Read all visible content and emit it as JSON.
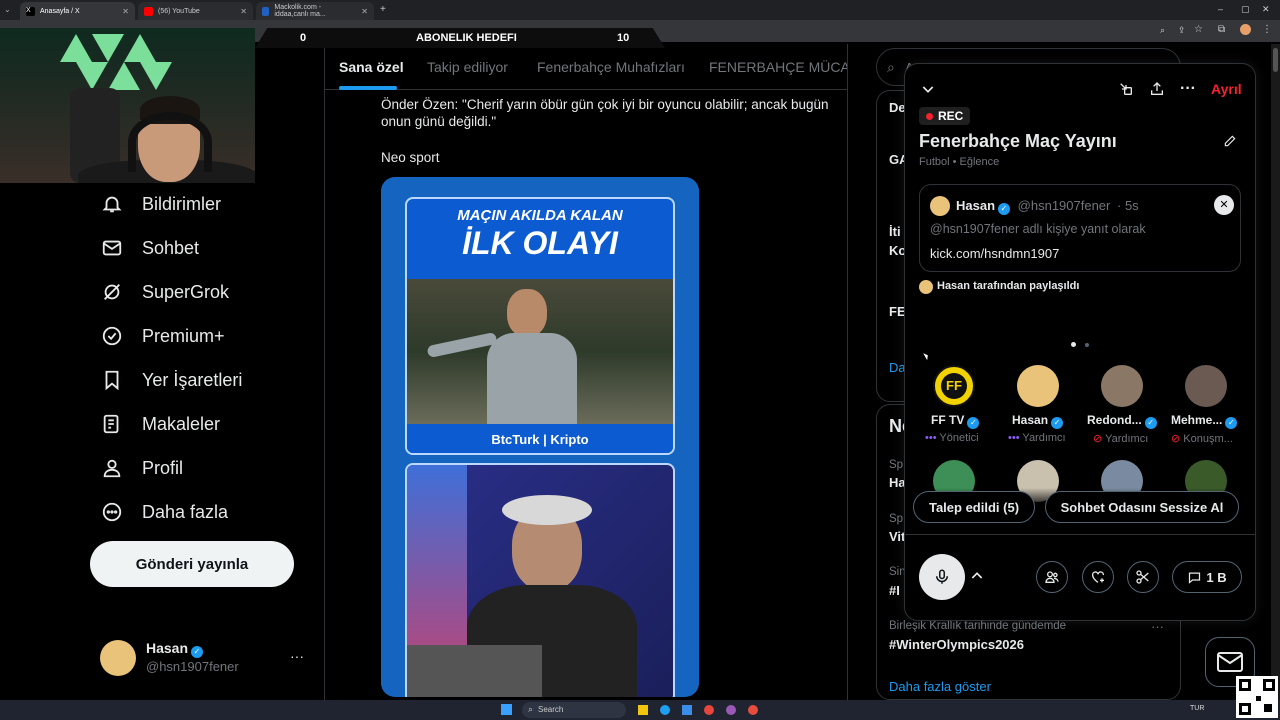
{
  "browser": {
    "tabs": [
      {
        "title": "Anasayfa / X",
        "active": true
      },
      {
        "title": "(56) YouTube",
        "active": false
      },
      {
        "title": "Mackolik.com - iddaa,canlı ma...",
        "active": false
      }
    ],
    "new_tab": "+"
  },
  "overlay": {
    "left_count": "0",
    "goal_label": "ABONELIK HEDEFI",
    "right_count": "10"
  },
  "nav": {
    "items": [
      {
        "label": "Bildirimler",
        "icon": "bell-icon"
      },
      {
        "label": "Sohbet",
        "icon": "mail-icon"
      },
      {
        "label": "SuperGrok",
        "icon": "grok-icon"
      },
      {
        "label": "Premium+",
        "icon": "verified-badge-icon"
      },
      {
        "label": "Yer İşaretleri",
        "icon": "bookmark-icon"
      },
      {
        "label": "Makaleler",
        "icon": "article-icon"
      },
      {
        "label": "Profil",
        "icon": "person-icon"
      },
      {
        "label": "Daha fazla",
        "icon": "more-circle-icon"
      }
    ],
    "post_button": "Gönderi yayınla",
    "account": {
      "name": "Hasan",
      "handle": "@hsn1907fener",
      "more": "···"
    }
  },
  "feed": {
    "tabs": [
      "Sana özel",
      "Takip ediliyor",
      "Fenerbahçe Muhafızları",
      "FENERBAHÇE MÜCADE"
    ],
    "tweet_text": "Önder Özen: \"Cherif yarın öbür gün çok iyi bir oyuncu olabilir; ancak bugün onun günü değildi.\"",
    "tweet_source": "Neo sport",
    "card1": {
      "line1": "MAÇIN AKILDA KALAN",
      "line2": "İLK OLAYI",
      "sponsor": "BtcTurk | Kripto"
    }
  },
  "right": {
    "search_placeholder": "A",
    "snippets": [
      "De",
      "GA",
      "İti",
      "Ko",
      "FE",
      "Da",
      "Ne",
      "Sp",
      "Ha",
      "Sp",
      "Vit",
      "Sin",
      "#I"
    ],
    "trend_context": "Birleşik Krallık tarihinde gündemde",
    "trend_name": "#WinterOlympics2026",
    "show_more": "Daha fazla göster",
    "trend_more": "···"
  },
  "space": {
    "leave_label": "Ayrıl",
    "rec_label": "REC",
    "title": "Fenerbahçe Maç Yayını",
    "subtitle": "Futbol • Eğlence",
    "pinned": {
      "name": "Hasan",
      "handle": "@hsn1907fener",
      "time": "· 5s",
      "reply_to": "@hsn1907fener adlı kişiye yanıt olarak",
      "text": "kick.com/hsndmn1907"
    },
    "shared_by": "Hasan tarafından paylaşıldı",
    "participants": [
      {
        "name": "FF TV",
        "role": "Yönetici",
        "role_icon": "dots"
      },
      {
        "name": "Hasan",
        "role": "Yardımcı",
        "role_icon": "dots"
      },
      {
        "name": "Redond...",
        "role": "Yardımcı",
        "role_icon": "mic-off"
      },
      {
        "name": "Mehme...",
        "role": "Konuşm...",
        "role_icon": "mic-off"
      }
    ],
    "requests_button": "Talep edildi (5)",
    "mute_button": "Sohbet Odasını Sessize Al",
    "comments_button": "1 B"
  },
  "taskbar": {
    "search_placeholder": "Search",
    "lang": "TUR"
  },
  "colors": {
    "accent": "#1d9bf0",
    "leave": "#f4212e",
    "card_blue": "#1565c0"
  }
}
